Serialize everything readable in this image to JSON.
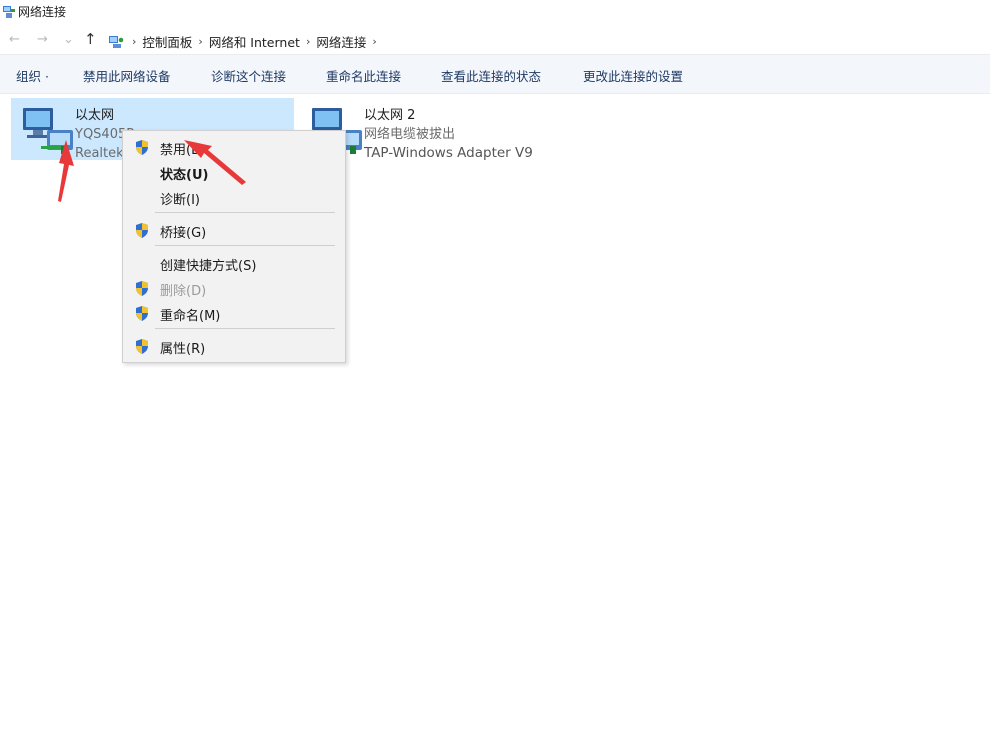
{
  "window": {
    "title": "网络连接",
    "icon": "network-connections-icon"
  },
  "address": {
    "back_icon": "←",
    "forward_icon": "→",
    "recent_icon": "⌄",
    "up_icon": "↑",
    "crumbs": [
      "控制面板",
      "网络和 Internet",
      "网络连接"
    ],
    "separator": "›"
  },
  "toolbar": {
    "organize": "组织 ·",
    "disable": "禁用此网络设备",
    "diagnose": "诊断这个连接",
    "rename": "重命名此连接",
    "view_status": "查看此连接的状态",
    "change_settings": "更改此连接的设置"
  },
  "connections": [
    {
      "name": "以太网",
      "status": "YQS405P",
      "device": "Realtek"
    },
    {
      "name": "以太网 2",
      "status": "网络电缆被拔出",
      "device": "TAP-Windows Adapter V9"
    }
  ],
  "context_menu": {
    "disable": "禁用(B)",
    "status": "状态(U)",
    "diagnose": "诊断(I)",
    "bridge": "桥接(G)",
    "create_shortcut": "创建快捷方式(S)",
    "delete": "删除(D)",
    "rename": "重命名(M)",
    "properties": "属性(R)"
  },
  "colors": {
    "selection": "#cce8ff",
    "toolbar_bg": "#f3f6fb",
    "annotation_arrow": "#e8393a",
    "shield_blue": "#2f6fd1",
    "shield_yellow": "#f2c12e"
  }
}
